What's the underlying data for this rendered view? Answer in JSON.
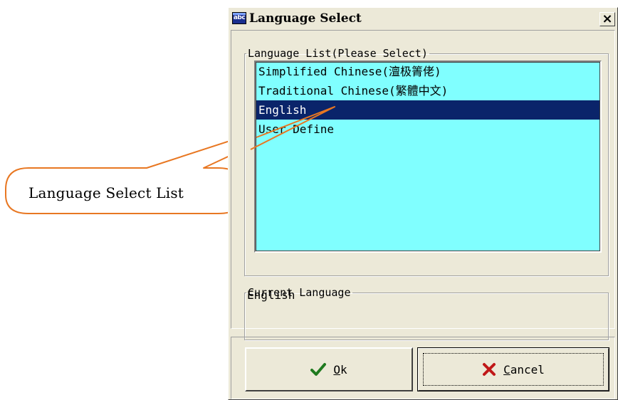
{
  "dialog": {
    "title": "Language Select",
    "app_icon_text": "abc",
    "close_glyph": "×"
  },
  "language_list": {
    "group_label": "Language List(Please Select)",
    "items": [
      {
        "label": "Simplified Chinese(澶极箐佬)",
        "selected": false
      },
      {
        "label": "Traditional Chinese(繁體中文)",
        "selected": false
      },
      {
        "label": "English",
        "selected": true
      },
      {
        "label": "User Define",
        "selected": false
      }
    ],
    "background_color": "#80ffff",
    "selection_color": "#0a246a"
  },
  "current_language": {
    "group_label": "Current Language",
    "value": "English"
  },
  "buttons": {
    "ok_label_accel": "O",
    "ok_label_rest": "k",
    "ok_icon": "check-icon",
    "cancel_label_accel": "C",
    "cancel_label_rest": "ancel",
    "cancel_icon": "x-icon"
  },
  "annotation": {
    "text": "Language Select List",
    "color": "#e87722"
  }
}
